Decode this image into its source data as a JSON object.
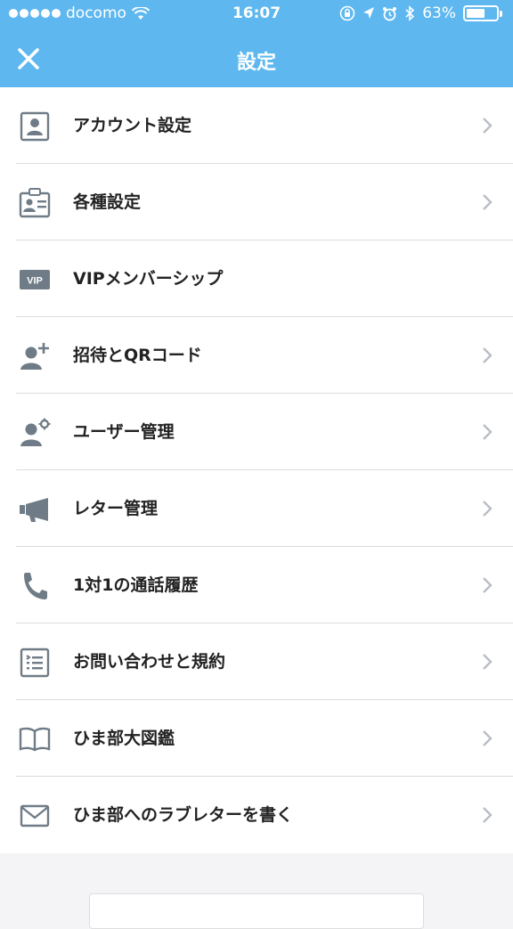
{
  "status_bar": {
    "carrier": "docomo",
    "time": "16:07",
    "battery": "63%",
    "battery_level": 0.63
  },
  "nav": {
    "title": "設定",
    "close_icon": "close-icon"
  },
  "menu": [
    {
      "label": "アカウント設定",
      "icon": "account-icon",
      "chevron": true
    },
    {
      "label": "各種設定",
      "icon": "id-card-icon",
      "chevron": true
    },
    {
      "label": "VIPメンバーシップ",
      "icon": "vip-badge-icon",
      "chevron": false
    },
    {
      "label": "招待とQRコード",
      "icon": "add-user-icon",
      "chevron": true
    },
    {
      "label": "ユーザー管理",
      "icon": "user-settings-icon",
      "chevron": true
    },
    {
      "label": "レター管理",
      "icon": "megaphone-icon",
      "chevron": true
    },
    {
      "label": "1対1の通話履歴",
      "icon": "phone-icon",
      "chevron": true
    },
    {
      "label": "お問い合わせと規約",
      "icon": "list-icon",
      "chevron": true
    },
    {
      "label": "ひま部大図鑑",
      "icon": "book-icon",
      "chevron": true
    },
    {
      "label": "ひま部へのラブレターを書く",
      "icon": "mail-icon",
      "chevron": true
    }
  ],
  "vip_badge_text": "VIP",
  "colors": {
    "header": "#5eb8ef",
    "icon": "#6f7c87",
    "chevron": "#b9bec4",
    "background": "#f4f4f6"
  }
}
